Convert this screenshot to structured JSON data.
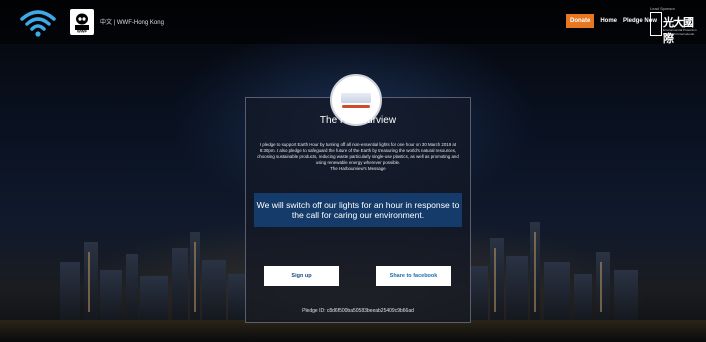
{
  "header": {
    "brand_text": "中文 | WWF-Hong Kong",
    "nav": {
      "donate": "Donate",
      "home": "Home",
      "pledge_now": "Pledge Now"
    },
    "sponsor": {
      "label": "Lead Sponsor",
      "name_cn": "光大國際",
      "name_en": "Environmental Protection Everbright International"
    },
    "icons": {
      "wifi": "wifi-icon",
      "logo": "wwf-panda-logo"
    }
  },
  "card": {
    "title": "The Harbourview",
    "pledge_text": "I pledge to support Earth Hour by turning off all non-essential lights for one hour on 30 March 2019 at 8:30pm. I also pledge to safeguard the future of the Earth by treasuring the world's natural resources, choosing sustainable products, reducing waste particularly single-use plastics, as well as promoting and using renewable energy wherever possible.",
    "message_label": "The Harbourview's Message",
    "banner_text": "We will switch off our lights for an hour in response to the call for caring our environment.",
    "signup_label": "Sign up",
    "share_label": "Share to facebook",
    "pledge_id": "Pledge ID: c8d6f500ba50583beeab25409c9b66ad"
  },
  "colors": {
    "donate": "#e87722",
    "banner": "#143b6a",
    "background": "#05070d"
  }
}
